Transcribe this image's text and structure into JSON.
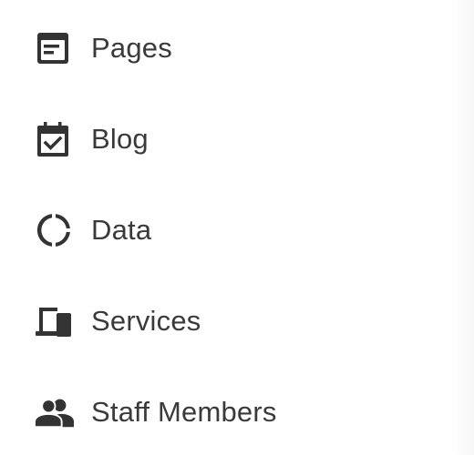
{
  "nav": {
    "items": [
      {
        "label": "Pages",
        "icon": "pages-icon"
      },
      {
        "label": "Blog",
        "icon": "calendar-check-icon"
      },
      {
        "label": "Data",
        "icon": "donut-chart-icon"
      },
      {
        "label": "Services",
        "icon": "devices-icon"
      },
      {
        "label": "Staff Members",
        "icon": "people-icon"
      }
    ]
  },
  "colors": {
    "icon": "#333333",
    "text": "#3a3a3a",
    "background": "#ffffff"
  }
}
